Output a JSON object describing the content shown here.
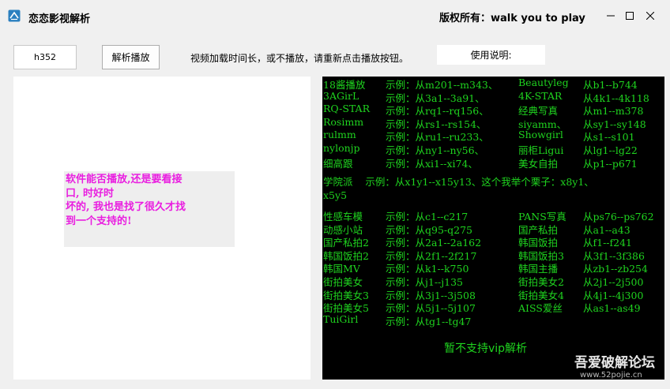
{
  "window": {
    "title": "恋恋影视解析",
    "copyright": "版权所有：walk you to play",
    "app_icon": "app-logo-icon",
    "controls": [
      "minimize-icon",
      "maximize-icon",
      "close-icon"
    ]
  },
  "toolbar": {
    "url_value": "h352",
    "play_button": "解析播放",
    "notice": "视频加载时间长，或不播放，请重新点击播放按钮。",
    "usage_label": "使用说明:"
  },
  "note": {
    "text": "软件能否播放,还是要看接\n口, 时好时\n坏的, 我也是找了很久才找\n到一个支持的!"
  },
  "console": {
    "rows": [
      {
        "name": "18酱播放",
        "ex": "示例：从m201--m343、",
        "name2": "Beautyleg",
        "ex2": "从b1--b744"
      },
      {
        "name": "3AGirL",
        "ex": "示例：从3a1--3a91、",
        "name2": "4K-STAR",
        "ex2": "从4k1--4k118"
      },
      {
        "name": "RQ-STAR",
        "ex": "示例：从rq1--rq156、",
        "name2": "经典写真",
        "ex2": "从m1--m378"
      },
      {
        "name": "Rosimm",
        "ex": "示例：从rs1--rs154、",
        "name2": "siyamm、",
        "ex2": "从sy1--sy148"
      },
      {
        "name": "rulmm",
        "ex": "示例：从ru1--ru233、",
        "name2": "Showgirl",
        "ex2": "从s1--s101"
      },
      {
        "name": "nylonjp",
        "ex": "示例：从ny1--ny56、",
        "name2": "丽柜Ligui",
        "ex2": "从lg1--lg22"
      },
      {
        "name": "细高跟",
        "ex": "示例：从xi1--xi74、",
        "name2": "美女自拍",
        "ex2": "从p1--p671"
      }
    ],
    "wide_line_1": "学院派    示例：从x1y1--x15y13、这个我举个栗子：x8y1、",
    "wide_line_2": "x5y5",
    "rows2": [
      {
        "name": "性感车模",
        "ex": "示例：从c1--c217",
        "name2": "PANS写真",
        "ex2": "从ps76--ps762"
      },
      {
        "name": "动感小站",
        "ex": "示例：从q95-q275",
        "name2": "国产私拍",
        "ex2": "从a1--a43"
      },
      {
        "name": "国产私拍2",
        "ex": "示例：从2a1--2a162",
        "name2": "韩国饭拍",
        "ex2": "从f1--f241"
      },
      {
        "name": "韩国饭拍2",
        "ex": "示例：从2f1--2f217",
        "name2": "韩国饭拍3",
        "ex2": "从3f1--3f386"
      },
      {
        "name": "韩国MV",
        "ex": "示例：从k1--k750",
        "name2": "韩国主播",
        "ex2": "从zb1--zb254"
      },
      {
        "name": "街拍美女",
        "ex": "示例：从j1--j135",
        "name2": "街拍美女2",
        "ex2": "从2j1--2j500"
      },
      {
        "name": "街拍美女3",
        "ex": "示例：从3j1--3j508",
        "name2": "街拍美女4",
        "ex2": "从4j1--4j300"
      },
      {
        "name": "街拍美女5",
        "ex": "示例：从5j1--5j107",
        "name2": "AISS爱丝",
        "ex2": "从as1--as49"
      },
      {
        "name": "TuiGirl",
        "ex": "示例：从tg1--tg47",
        "name2": "",
        "ex2": ""
      }
    ],
    "footer": "暂不支持vip解析"
  },
  "watermark": {
    "line1": "吾爱破解论坛",
    "line2": "www.52pojie.cn"
  },
  "colors": {
    "console_text": "#1fd41f",
    "note_text": "#e91ee0"
  }
}
